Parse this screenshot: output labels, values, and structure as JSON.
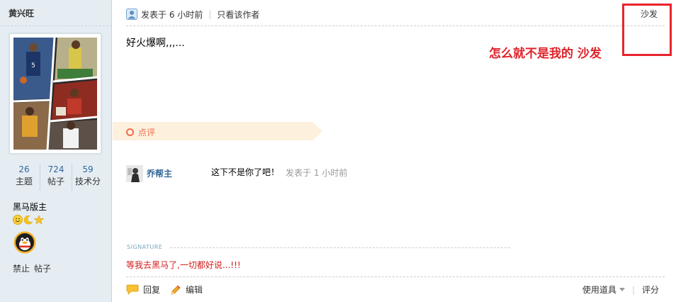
{
  "author": {
    "name": "黄兴旺",
    "stats": [
      {
        "value": "26",
        "label": "主题"
      },
      {
        "value": "724",
        "label": "帖子"
      },
      {
        "value": "59",
        "label": "技术分"
      }
    ],
    "group": "黑马版主",
    "admin_links": [
      "禁止",
      "帖子"
    ]
  },
  "post": {
    "time": "发表于 6 小时前",
    "author_only": "只看该作者",
    "floor": "沙发",
    "body": "好火爆啊,,,...",
    "annotation": "怎么就不是我的 沙发"
  },
  "comment": {
    "label": "点评",
    "user": "乔帮主",
    "text": "这下不是你了吧！",
    "time": "发表于 1 小时前"
  },
  "signature": {
    "label": "SIGNATURE",
    "text": "等我去黑马了,一切都好说...!!!"
  },
  "footer": {
    "reply": "回复",
    "edit": "编辑",
    "tools": "使用道具",
    "rate": "评分"
  },
  "colors": {
    "sidebar_bg": "#e5edf2",
    "link_blue": "#336699",
    "annotation_red": "#e0222a",
    "comment_orange": "#f26c4f",
    "signature_red": "#d31c1c"
  }
}
